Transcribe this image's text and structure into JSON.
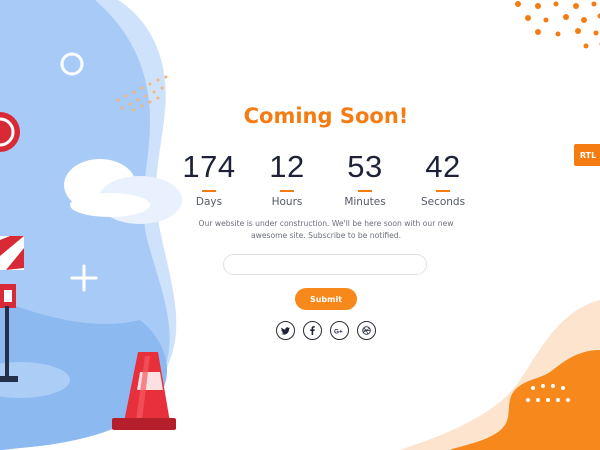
{
  "heading": "Coming Soon!",
  "countdown": [
    {
      "value": "174",
      "label": "Days"
    },
    {
      "value": "12",
      "label": "Hours"
    },
    {
      "value": "53",
      "label": "Minutes"
    },
    {
      "value": "42",
      "label": "Seconds"
    }
  ],
  "description": "Our website is under construction. We'll be here soon with our new awesome site. Subscribe to be notified.",
  "subscribe": {
    "email_value": "",
    "email_placeholder": "",
    "button_label": "Submit"
  },
  "social_icons": [
    "twitter-icon",
    "facebook-icon",
    "google-plus-icon",
    "dribbble-icon"
  ],
  "rtl_label": "RTL",
  "colors": {
    "accent": "#f47c12",
    "text_dark": "#1d2238",
    "blob_blue": "#a9cdf7",
    "blob_light": "#c9e0fb",
    "peach": "#fde3cc"
  }
}
